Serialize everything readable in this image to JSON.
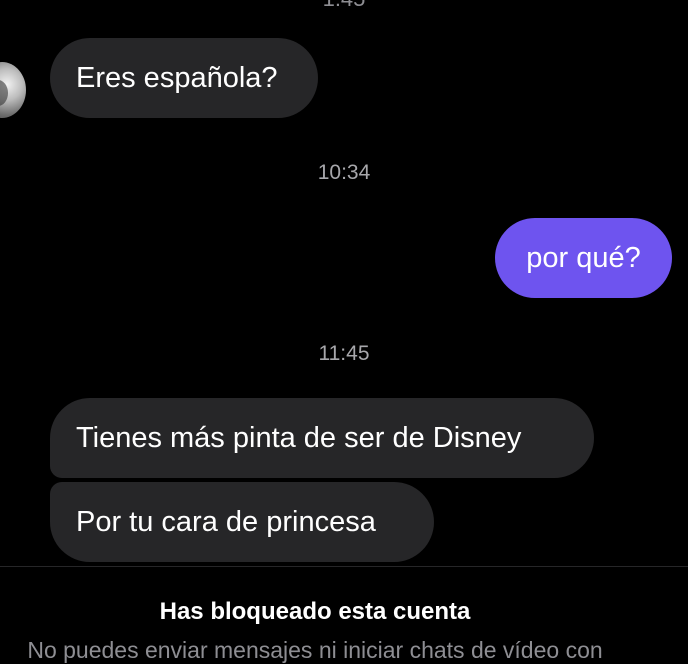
{
  "conversation": {
    "top_timestamp_partial": "1:45",
    "messages": [
      {
        "direction": "incoming",
        "text": "Eres española?"
      },
      {
        "type": "timestamp",
        "text": "10:34"
      },
      {
        "direction": "outgoing",
        "text": "por qué?"
      },
      {
        "type": "timestamp",
        "text": "11:45"
      },
      {
        "direction": "incoming",
        "text": "Tienes más pinta de ser de Disney"
      },
      {
        "direction": "incoming",
        "text": "Por tu cara de princesa"
      }
    ]
  },
  "blocked_notice": {
    "title": "Has bloqueado esta cuenta",
    "subtitle": "No puedes enviar mensajes ni iniciar chats de vídeo con"
  },
  "colors": {
    "background": "#000000",
    "incoming_bubble": "#262628",
    "outgoing_bubble": "#6e54ef",
    "timestamp_text": "#a7a7ab",
    "secondary_text": "#8e8e93"
  }
}
